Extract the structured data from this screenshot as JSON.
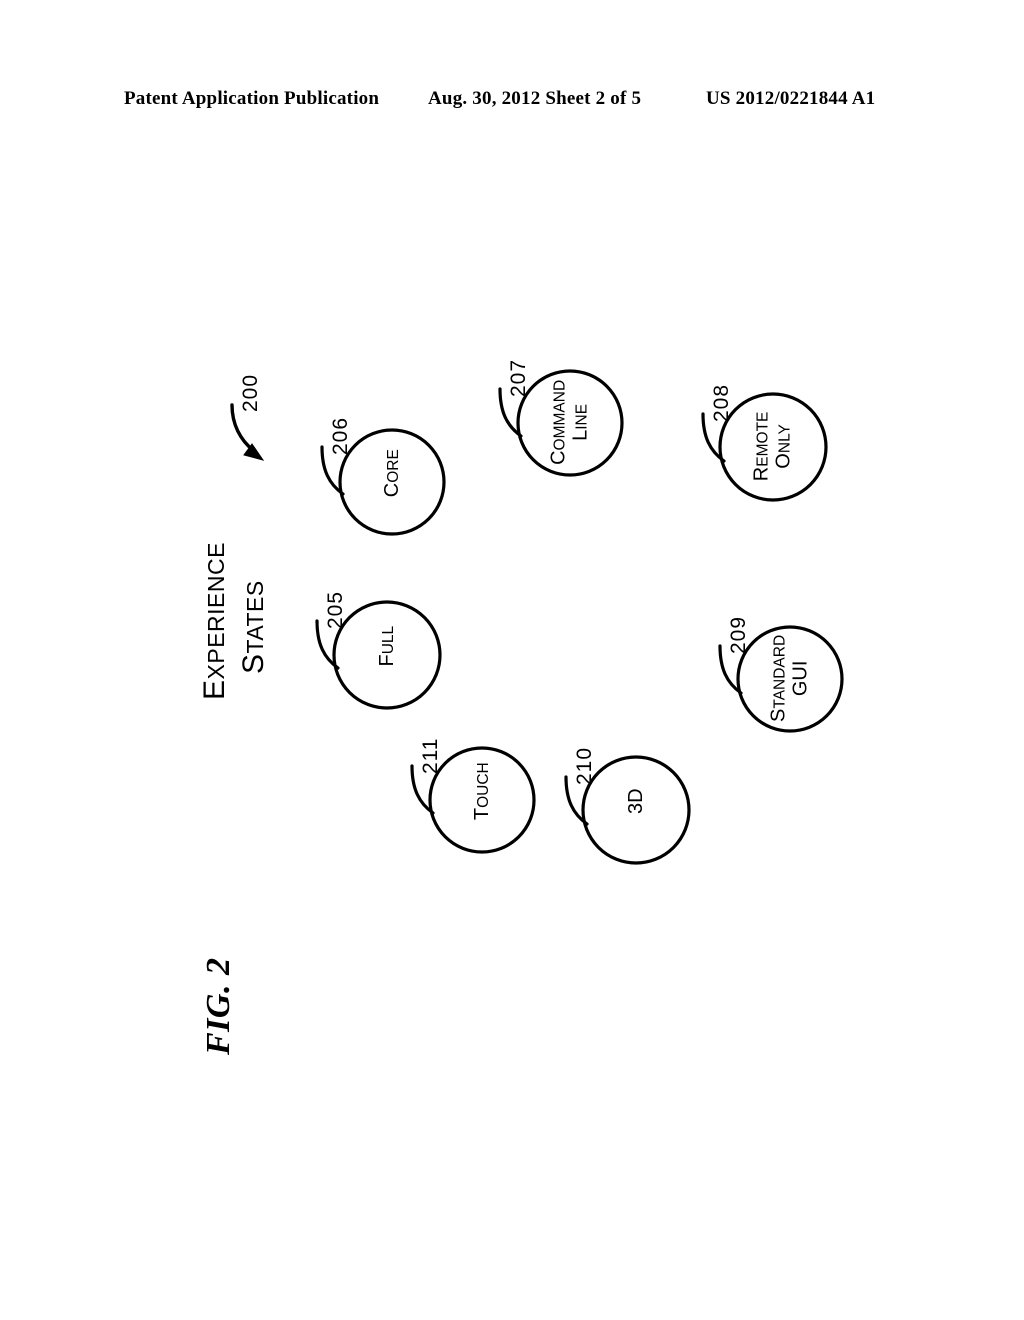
{
  "header": {
    "left": "Patent Application Publication",
    "middle": "Aug. 30, 2012  Sheet 2 of 5",
    "right": "US 2012/0221844 A1"
  },
  "figure": {
    "label": "FIG. 2",
    "title_line1_first": "E",
    "title_line1_rest": "XPERIENCE",
    "title_line2_first": "S",
    "title_line2_rest": "TATES",
    "diagram_ref": "200",
    "ink_color": "#000000",
    "background_color": "#ffffff"
  },
  "nodes": [
    {
      "id": "full",
      "ref": "205",
      "line1_first": "F",
      "line1_rest": "ULL",
      "line2_first": "",
      "line2_rest": ""
    },
    {
      "id": "core",
      "ref": "206",
      "line1_first": "C",
      "line1_rest": "ORE",
      "line2_first": "",
      "line2_rest": ""
    },
    {
      "id": "command-line",
      "ref": "207",
      "line1_first": "C",
      "line1_rest": "OMMAND",
      "line2_first": "L",
      "line2_rest": "INE"
    },
    {
      "id": "remote-only",
      "ref": "208",
      "line1_first": "R",
      "line1_rest": "EMOTE",
      "line2_first": "O",
      "line2_rest": "NLY"
    },
    {
      "id": "standard-gui",
      "ref": "209",
      "line1_first": "S",
      "line1_rest": "TANDARD",
      "line2_first": "GUI",
      "line2_rest": ""
    },
    {
      "id": "three-d",
      "ref": "210",
      "line1_first": "3D",
      "line1_rest": "",
      "line2_first": "",
      "line2_rest": ""
    },
    {
      "id": "touch",
      "ref": "211",
      "line1_first": "T",
      "line1_rest": "OUCH",
      "line2_first": "",
      "line2_rest": ""
    }
  ]
}
